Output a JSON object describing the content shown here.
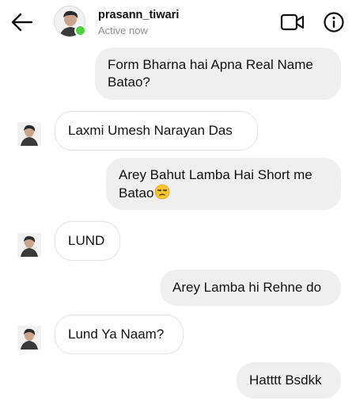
{
  "header": {
    "username": "prasann_tiwari",
    "status": "Active now",
    "online_color": "#4cd23a"
  },
  "icons": {
    "back": "back-arrow-icon",
    "video": "video-call-icon",
    "info": "info-icon"
  },
  "messages": [
    {
      "side": "sent",
      "line1": "Form Bharna hai Apna Real Name",
      "line2": "Batao?"
    },
    {
      "side": "received",
      "text": "Laxmi Umesh Narayan Das"
    },
    {
      "side": "sent",
      "line1": "Arey Bahut Lamba Hai Short me",
      "line2": "Batao",
      "emoji": "😒"
    },
    {
      "side": "received",
      "text": "LUND"
    },
    {
      "side": "sent",
      "text": "Arey Lamba hi Rehne do"
    },
    {
      "side": "received",
      "text": "Lund Ya Naam?"
    },
    {
      "side": "sent",
      "text": "Hatttt Bsdkk"
    }
  ],
  "colors": {
    "sent_bubble": "#efefef",
    "received_border": "#e3e3e3",
    "status_text": "#8e8e8e"
  }
}
